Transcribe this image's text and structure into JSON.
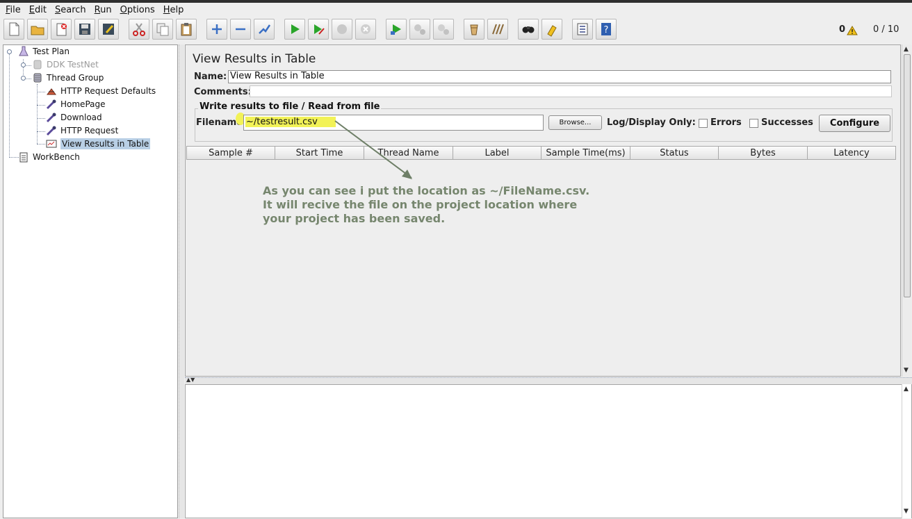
{
  "menu": [
    "File",
    "Edit",
    "Search",
    "Run",
    "Options",
    "Help"
  ],
  "menu_underline": [
    "F",
    "E",
    "S",
    "R",
    "O",
    "H"
  ],
  "toolbar": {
    "warning_count": "0",
    "thread_count": "0 / 10",
    "buttons": [
      "new-icon",
      "open-icon",
      "close-icon",
      "save-icon",
      "save-as-icon",
      "cut-icon",
      "copy-icon",
      "paste-icon",
      "expand-icon",
      "collapse-icon",
      "toggle-icon",
      "start-icon",
      "start-no-pause-icon",
      "stop-icon",
      "shutdown-icon",
      "remote-start-icon",
      "remote-stop-icon",
      "remote-shutdown-icon",
      "clear-icon",
      "clear-all-icon",
      "search-icon",
      "reset-search-icon",
      "function-helper-icon",
      "help-icon"
    ]
  },
  "tree": {
    "items": [
      {
        "label": "Test Plan"
      },
      {
        "label": "DDK TestNet"
      },
      {
        "label": "Thread Group"
      },
      {
        "label": "HTTP Request Defaults"
      },
      {
        "label": "HomePage"
      },
      {
        "label": "Download"
      },
      {
        "label": "HTTP Request"
      },
      {
        "label": "View Results in Table"
      },
      {
        "label": "WorkBench"
      }
    ]
  },
  "panel": {
    "title": "View Results in Table",
    "name_label": "Name:",
    "name_value": "View Results in Table",
    "comments_label": "Comments:",
    "file_group_label": "Write results to file / Read from file",
    "filename_label": "Filename",
    "filename_value": "~/testresult.csv",
    "browse_label": "Browse...",
    "log_display_label": "Log/Display Only:",
    "errors_label": "Errors",
    "successes_label": "Successes",
    "configure_label": "Configure"
  },
  "table": {
    "columns": [
      "Sample #",
      "Start Time",
      "Thread Name",
      "Label",
      "Sample Time(ms)",
      "Status",
      "Bytes",
      "Latency"
    ]
  },
  "annotation": {
    "line1": "As you can see i put the location as ~/FileName.csv.",
    "line2": "It will recive the file on the project location where",
    "line3": "your project has been saved."
  },
  "colors": {
    "annotation": "#76866e",
    "highlight": "#f2f257",
    "selection": "#b8cfe5"
  }
}
